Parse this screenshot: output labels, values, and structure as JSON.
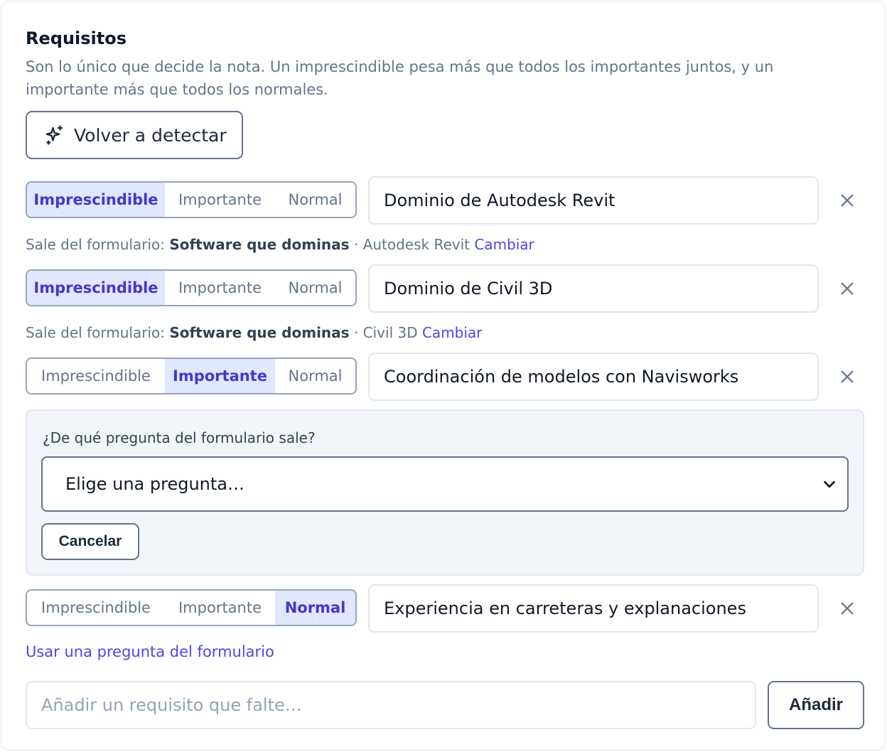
{
  "section": {
    "title": "Requisitos",
    "description": "Son lo único que decide la nota. Un imprescindible pesa más que todos los importantes juntos, y un importante más que todos los normales.",
    "detect_label": "Volver a detectar",
    "detect_icon": "sparkles-icon"
  },
  "priority_options": [
    "Imprescindible",
    "Importante",
    "Normal"
  ],
  "requirements": [
    {
      "selected": "Imprescindible",
      "text": "Dominio de Autodesk Revit",
      "origin_prefix": "Sale del formulario:",
      "origin_question": "Software que dominas",
      "origin_answer": "· Autodesk Revit",
      "origin_change": "Cambiar"
    },
    {
      "selected": "Imprescindible",
      "text": "Dominio de Civil 3D",
      "origin_prefix": "Sale del formulario:",
      "origin_question": "Software que dominas",
      "origin_answer": "· Civil 3D",
      "origin_change": "Cambiar"
    },
    {
      "selected": "Importante",
      "text": "Coordinación de modelos con Navisworks"
    },
    {
      "selected": "Normal",
      "text": "Experiencia en carreteras y explanaciones"
    }
  ],
  "question_picker": {
    "label": "¿De qué pregunta del formulario sale?",
    "selected_value": "Elige una pregunta…",
    "cancel_label": "Cancelar"
  },
  "use_question_link": "Usar una pregunta del formulario",
  "add": {
    "placeholder": "Añadir un requisito que falte…",
    "button_label": "Añadir"
  },
  "colors": {
    "accent": "#4f46e5",
    "active_bg": "#e0e7ff",
    "muted_text": "#64748b",
    "panel_bg": "#f1f5f9"
  }
}
